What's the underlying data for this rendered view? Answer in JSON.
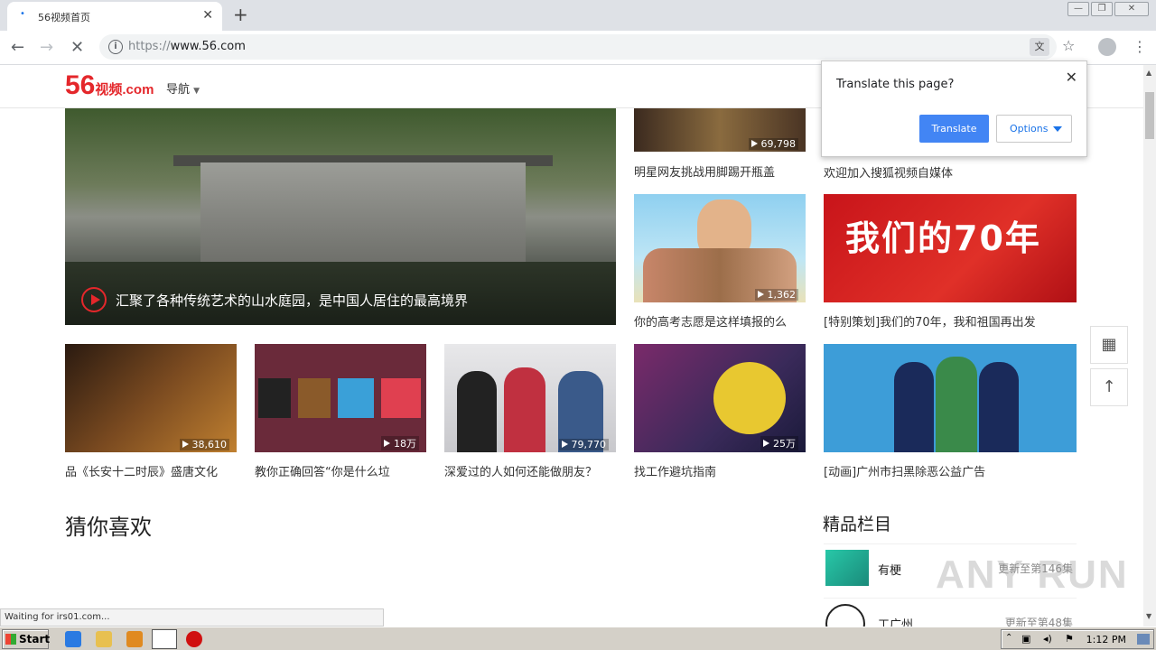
{
  "browser": {
    "tab_title": "56视频首页",
    "url_scheme": "https://",
    "url_host": "www.56.com",
    "status_text": "Waiting for irs01.com..."
  },
  "site": {
    "logo_main": "56",
    "logo_sub": "视频",
    "logo_domain": ".com",
    "nav_label": "导航"
  },
  "hero": {
    "caption": "汇聚了各种传统艺术的山水庭园，是中国人居住的最高境界"
  },
  "thumbs": [
    {
      "count": "69,798",
      "caption": "明星网友挑战用脚踢开瓶盖"
    },
    {
      "count": "",
      "caption": "欢迎加入搜狐视频自媒体"
    },
    {
      "count": "1,362",
      "caption": "你的高考志愿是这样填报的么"
    },
    {
      "count": "",
      "caption": "[特别策划]我们的70年，我和祖国再出发",
      "banner": "我们的70年"
    },
    {
      "count": "38,610",
      "caption": "品《长安十二时辰》盛唐文化"
    },
    {
      "count": "18万",
      "caption": "教你正确回答“你是什么垃"
    },
    {
      "count": "79,770",
      "caption": "深爱过的人如何还能做朋友？"
    },
    {
      "count": "25万",
      "caption": "找工作避坑指南"
    },
    {
      "count": "",
      "caption": "[动画]广州市扫黑除恶公益广告"
    }
  ],
  "sections": {
    "recommend": "猜你喜欢",
    "premium": "精品栏目"
  },
  "programs": [
    {
      "name": "有梗",
      "update": "更新至第146集"
    },
    {
      "name": "工广州",
      "update": "更新至第48集"
    }
  ],
  "translate_popup": {
    "question": "Translate this page?",
    "translate_label": "Translate",
    "options_label": "Options"
  },
  "taskbar": {
    "start_label": "Start",
    "clock": "1:12 PM"
  },
  "watermark": "ANY RUN"
}
